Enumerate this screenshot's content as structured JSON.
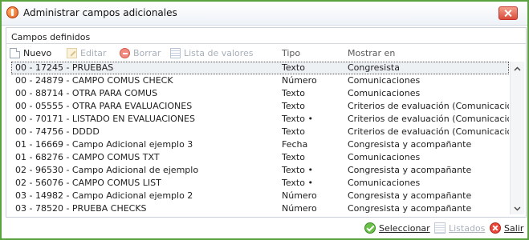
{
  "window": {
    "title": "Administrar campos adicionales"
  },
  "group": {
    "title": "Campos definidos"
  },
  "toolbar": {
    "new_label": "Nuevo",
    "edit_label": "Editar",
    "delete_label": "Borrar",
    "values_label": "Lista de valores"
  },
  "columns": {
    "tipo": "Tipo",
    "mostrar": "Mostrar en"
  },
  "rows": [
    {
      "campo": "00 - 17245 - PRUEBAS",
      "tipo": "Texto",
      "mostrar": "Congresista"
    },
    {
      "campo": "00 - 24879 - CAMPO COMUS CHECK",
      "tipo": "Número",
      "mostrar": "Comunicaciones"
    },
    {
      "campo": "00 - 88714 - OTRA PARA COMUS",
      "tipo": "Texto",
      "mostrar": "Comunicaciones"
    },
    {
      "campo": "00 - 05555 - OTRA PARA EVALUACIONES",
      "tipo": "Texto",
      "mostrar": "Criterios de evaluación (Comunicaciones)"
    },
    {
      "campo": "00 - 70171 - LISTADO EN EVALUACIONES",
      "tipo": "Texto •",
      "mostrar": "Criterios de evaluación (Comunicaciones)"
    },
    {
      "campo": "00 - 74756 - DDDD",
      "tipo": "Texto",
      "mostrar": "Criterios de evaluación (Comunicaciones)"
    },
    {
      "campo": "01 - 16669 - Campo Adicional ejemplo 3",
      "tipo": "Fecha",
      "mostrar": "Congresista y acompañante"
    },
    {
      "campo": "01 - 68276 - CAMPO COMUS TXT",
      "tipo": "Texto",
      "mostrar": "Comunicaciones"
    },
    {
      "campo": "02 - 96530 - Campo Adicional de ejemplo",
      "tipo": "Texto •",
      "mostrar": "Congresista y acompañante"
    },
    {
      "campo": "02 - 56076 - CAMPO COMUS LIST",
      "tipo": "Texto •",
      "mostrar": "Comunicaciones"
    },
    {
      "campo": "03 - 14982 - Campo Adicional ejemplo 2",
      "tipo": "Número",
      "mostrar": "Congresista y acompañante"
    },
    {
      "campo": "03 - 78520 - PRUEBA CHECKS",
      "tipo": "Número",
      "mostrar": "Congresista y acompañante"
    }
  ],
  "footer": {
    "select_label": "Seleccionar",
    "listings_label": "Listados",
    "exit_label": "Salir"
  },
  "colors": {
    "window_border": "#58a33e",
    "selected_row": "#eef1f4"
  }
}
